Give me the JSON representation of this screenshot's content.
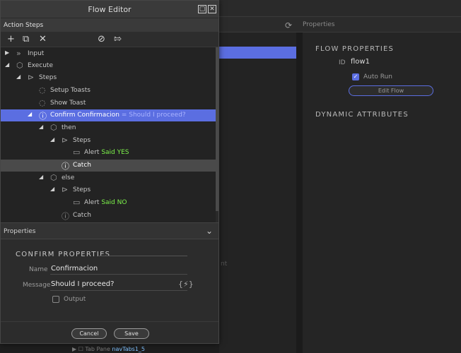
{
  "dialog": {
    "title": "Flow Editor",
    "action_steps_label": "Action Steps",
    "toolbar": {
      "add": "+",
      "copy": "⧉",
      "delete": "✕",
      "disable": "⊘",
      "export": "⇰"
    }
  },
  "tree": [
    {
      "label": "Input",
      "icon": "chevrons-right-icon",
      "arrow": "▶"
    },
    {
      "label": "Execute",
      "icon": "cube-icon",
      "arrow": "◢"
    },
    {
      "label": "Steps",
      "icon": "play-circle-icon",
      "arrow": "◢"
    },
    {
      "label": "Setup Toasts",
      "icon": "speech-bubble-icon"
    },
    {
      "label": "Show Toast",
      "icon": "speech-bubble-icon"
    },
    {
      "label": "Confirm Confirmacion",
      "suffix": "= Should I proceed?",
      "icon": "alert-bubble-icon",
      "arrow": "◢"
    },
    {
      "label": "then",
      "icon": "cube-icon",
      "arrow": "◢"
    },
    {
      "label": "Steps",
      "icon": "play-circle-icon",
      "arrow": "◢"
    },
    {
      "label": "Alert",
      "highlight": "Said YES",
      "icon": "message-icon"
    },
    {
      "label": "Catch",
      "icon": "alert-circle-icon"
    },
    {
      "label": "else",
      "icon": "cube-icon",
      "arrow": "◢"
    },
    {
      "label": "Steps",
      "icon": "play-circle-icon",
      "arrow": "◢"
    },
    {
      "label": "Alert",
      "highlight": "Said NO",
      "icon": "message-icon"
    },
    {
      "label": "Catch",
      "icon": "alert-circle-icon"
    }
  ],
  "properties": {
    "bar_label": "Properties",
    "section_title": "CONFIRM PROPERTIES",
    "name_label": "Name",
    "name_value": "Confirmacion",
    "message_label": "Message",
    "message_value": "Should I proceed?",
    "output_label": "Output"
  },
  "footer": {
    "cancel": "Cancel",
    "save": "Save"
  },
  "right_panel": {
    "title": "Properties",
    "flow_properties": "FLOW PROPERTIES",
    "id_label": "ID",
    "id_value": "flow1",
    "auto_run": "Auto Run",
    "edit_flow": "Edit Flow",
    "dynamic_attributes": "DYNAMIC ATTRIBUTES"
  },
  "background": {
    "fragment": "nt",
    "tab_pane_label": "Tab Pane",
    "tab_pane_id": "navTabs1_5"
  },
  "colors": {
    "accent": "#5b6ee1",
    "highlight_green": "#7cf24a",
    "catch_row": "#4a4a4a"
  }
}
